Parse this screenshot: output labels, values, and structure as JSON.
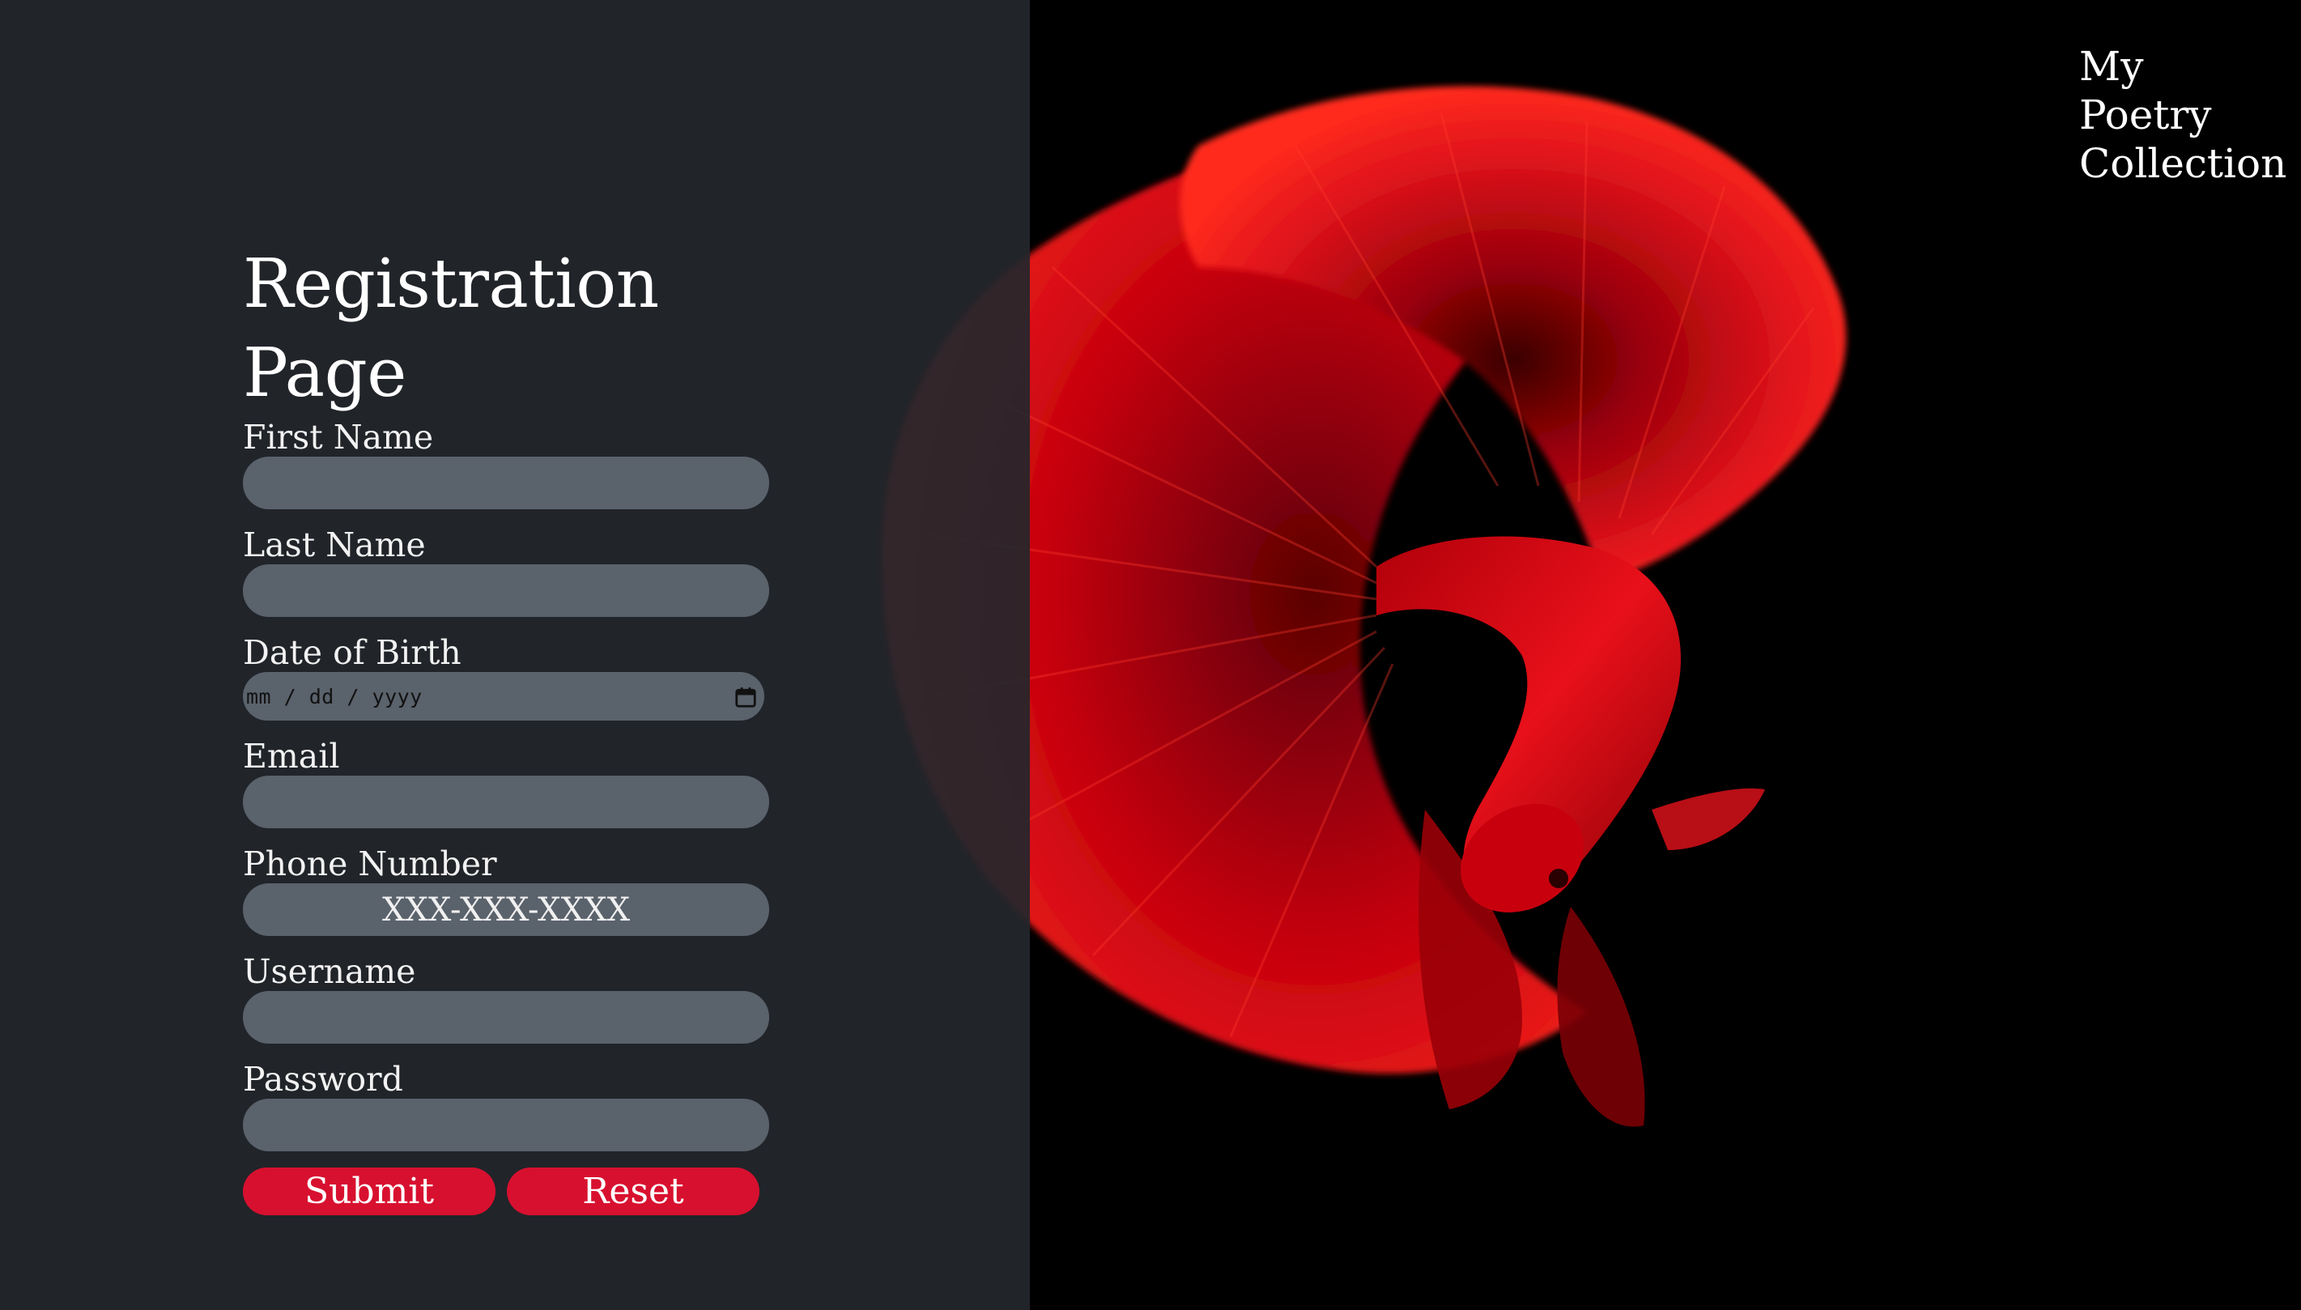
{
  "site": {
    "title_lines": [
      "My",
      "Poetry",
      "Collection"
    ]
  },
  "form": {
    "title": "Registration Page",
    "fields": {
      "first_name": {
        "label": "First Name",
        "value": "",
        "placeholder": ""
      },
      "last_name": {
        "label": "Last Name",
        "value": "",
        "placeholder": ""
      },
      "dob": {
        "label": "Date of Birth",
        "placeholder": "mm / dd / yyyy"
      },
      "email": {
        "label": "Email",
        "value": "",
        "placeholder": ""
      },
      "phone": {
        "label": "Phone Number",
        "value": "",
        "placeholder": "XXX-XXX-XXXX"
      },
      "username": {
        "label": "Username",
        "value": "",
        "placeholder": ""
      },
      "password": {
        "label": "Password",
        "value": "",
        "placeholder": ""
      }
    },
    "buttons": {
      "submit": "Submit",
      "reset": "Reset"
    }
  },
  "icons": {
    "calendar": "calendar-icon"
  },
  "colors": {
    "panel": "#24272c",
    "input": "#5a626c",
    "accent": "#d8102f",
    "background": "#000000",
    "fish": "#e0141c"
  }
}
